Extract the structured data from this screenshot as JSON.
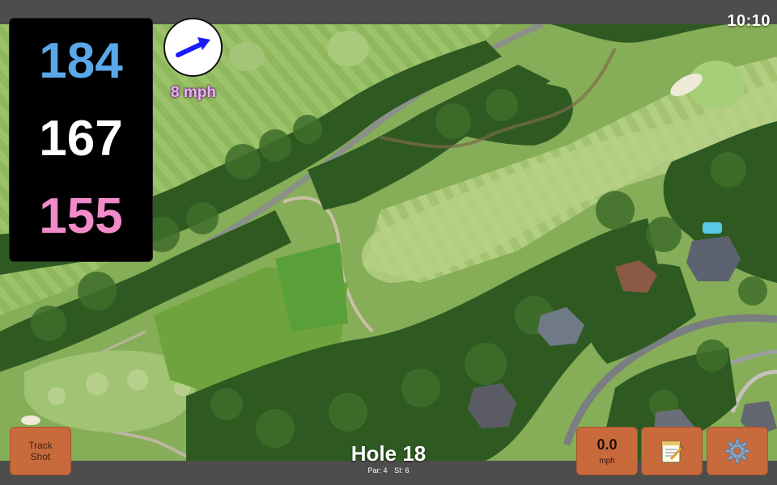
{
  "status_bar": {
    "time": "10:10"
  },
  "yardages": {
    "back": "184",
    "middle": "167",
    "front": "155",
    "colors": {
      "back": "#5aa8ea",
      "middle": "#ffffff",
      "front": "#f08ac8"
    }
  },
  "wind": {
    "speed_text": "8 mph",
    "direction_icon": "wind-arrow-icon",
    "arrow_color": "#1a1aff"
  },
  "buttons": {
    "track_shot_line1": "Track",
    "track_shot_line2": "Shot",
    "speed_value": "0.0",
    "speed_unit": "mph",
    "notes_icon": "notepad-icon",
    "settings_icon": "gear-icon"
  },
  "hole": {
    "title": "Hole 18",
    "par_label": "Par: 4",
    "si_label": "SI: 6"
  },
  "colors": {
    "button_bg": "#c96a3c",
    "bar_bg": "#4d4d4d",
    "wind_text": "#e7b6f3"
  }
}
